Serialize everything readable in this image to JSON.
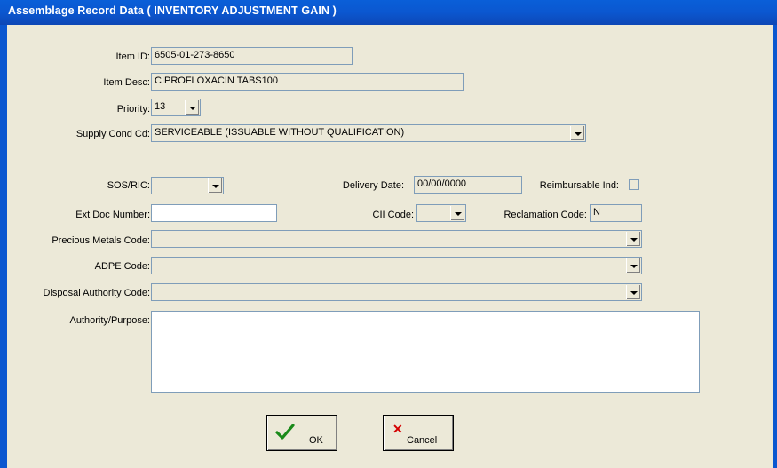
{
  "window": {
    "title": "Assemblage Record Data ( INVENTORY ADJUSTMENT GAIN )"
  },
  "form": {
    "item_id": {
      "label": "Item ID:",
      "value": "6505-01-273-8650"
    },
    "item_desc": {
      "label": "Item Desc:",
      "value": "CIPROFLOXACIN TABS100"
    },
    "priority": {
      "label": "Priority:",
      "value": "13"
    },
    "supply_cond": {
      "label": "Supply Cond Cd:",
      "value": "SERVICEABLE (ISSUABLE WITHOUT QUALIFICATION)"
    },
    "sos_ric": {
      "label": "SOS/RIC:",
      "value": ""
    },
    "delivery_date": {
      "label": "Delivery Date:",
      "value": "00/00/0000"
    },
    "reimbursable": {
      "label": "Reimbursable Ind:",
      "checked": false
    },
    "ext_doc": {
      "label": "Ext Doc Number:",
      "value": ""
    },
    "cii_code": {
      "label": "CII Code:",
      "value": ""
    },
    "reclamation": {
      "label": "Reclamation Code:",
      "value": "N"
    },
    "precious_metals": {
      "label": "Precious Metals Code:",
      "value": ""
    },
    "adpe": {
      "label": "ADPE Code:",
      "value": ""
    },
    "disposal": {
      "label": "Disposal Authority Code:",
      "value": ""
    },
    "authority": {
      "label": "Authority/Purpose:",
      "value": ""
    }
  },
  "buttons": {
    "ok": "OK",
    "cancel": "Cancel"
  },
  "icons": {
    "ok": "check-icon",
    "cancel": "x-icon",
    "check_color": "#1a8a1a",
    "x_color": "#d40000"
  }
}
